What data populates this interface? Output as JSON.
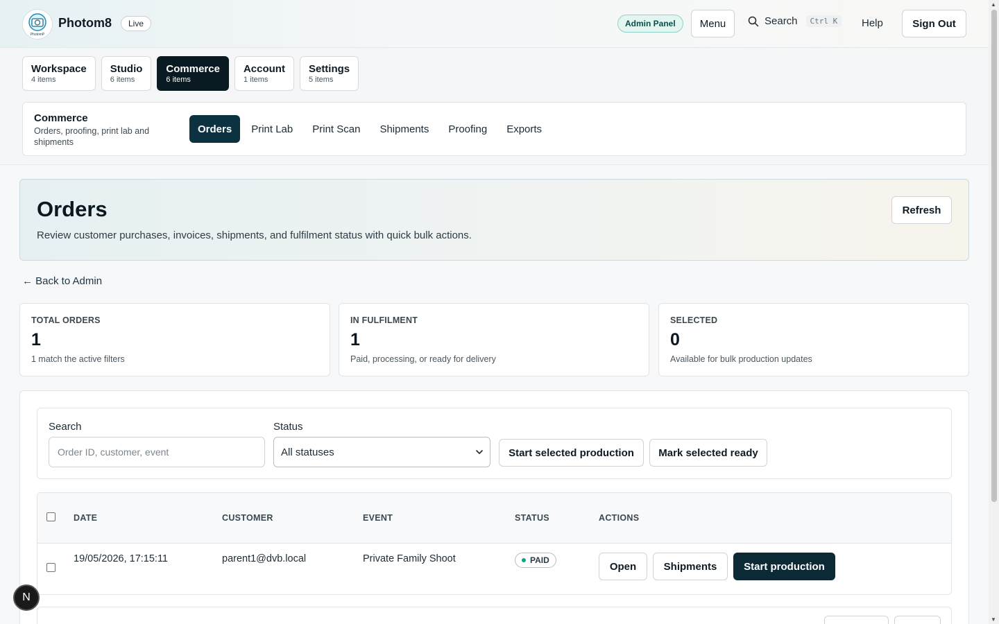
{
  "app": {
    "brand": "Photom8",
    "env_badge": "Live",
    "logo_text": "PhotomP",
    "admin_panel": "Admin Panel",
    "menu_label": "Menu",
    "search_label": "Search",
    "search_shortcut": "Ctrl K",
    "help_label": "Help",
    "signout_label": "Sign Out"
  },
  "section_tabs": [
    {
      "label": "Workspace",
      "count": "4 items"
    },
    {
      "label": "Studio",
      "count": "6 items"
    },
    {
      "label": "Commerce",
      "count": "6 items",
      "active": true
    },
    {
      "label": "Account",
      "count": "1 items"
    },
    {
      "label": "Settings",
      "count": "5 items"
    }
  ],
  "subnav": {
    "title": "Commerce",
    "description": "Orders, proofing, print lab and shipments",
    "tabs": [
      "Orders",
      "Print Lab",
      "Print Scan",
      "Shipments",
      "Proofing",
      "Exports"
    ],
    "active": "Orders"
  },
  "hero": {
    "title": "Orders",
    "description": "Review customer purchases, invoices, shipments, and fulfilment status with quick bulk actions.",
    "refresh_label": "Refresh"
  },
  "back_link": "← Back to Admin",
  "stats": [
    {
      "label": "TOTAL ORDERS",
      "value": "1",
      "sub": "1 match the active filters"
    },
    {
      "label": "IN FULFILMENT",
      "value": "1",
      "sub": "Paid, processing, or ready for delivery"
    },
    {
      "label": "SELECTED",
      "value": "0",
      "sub": "Available for bulk production updates"
    }
  ],
  "filters": {
    "search_label": "Search",
    "search_placeholder": "Order ID, customer, event",
    "status_label": "Status",
    "status_value": "All statuses",
    "bulk_start": "Start selected production",
    "bulk_ready": "Mark selected ready"
  },
  "table": {
    "columns": [
      "DATE",
      "CUSTOMER",
      "EVENT",
      "STATUS",
      "ACTIONS"
    ],
    "rows": [
      {
        "date": "19/05/2026, 17:15:11",
        "customer": "parent1@dvb.local",
        "event": "Private Family Shoot",
        "status": "PAID",
        "actions": [
          "Open",
          "Shipments",
          "Start production"
        ]
      }
    ]
  },
  "colors": {
    "primary_dark": "#0c2a36",
    "paid_dot": "#10a37f",
    "admin_pill_bg": "#e2f5f1"
  },
  "dev_badge": "N"
}
